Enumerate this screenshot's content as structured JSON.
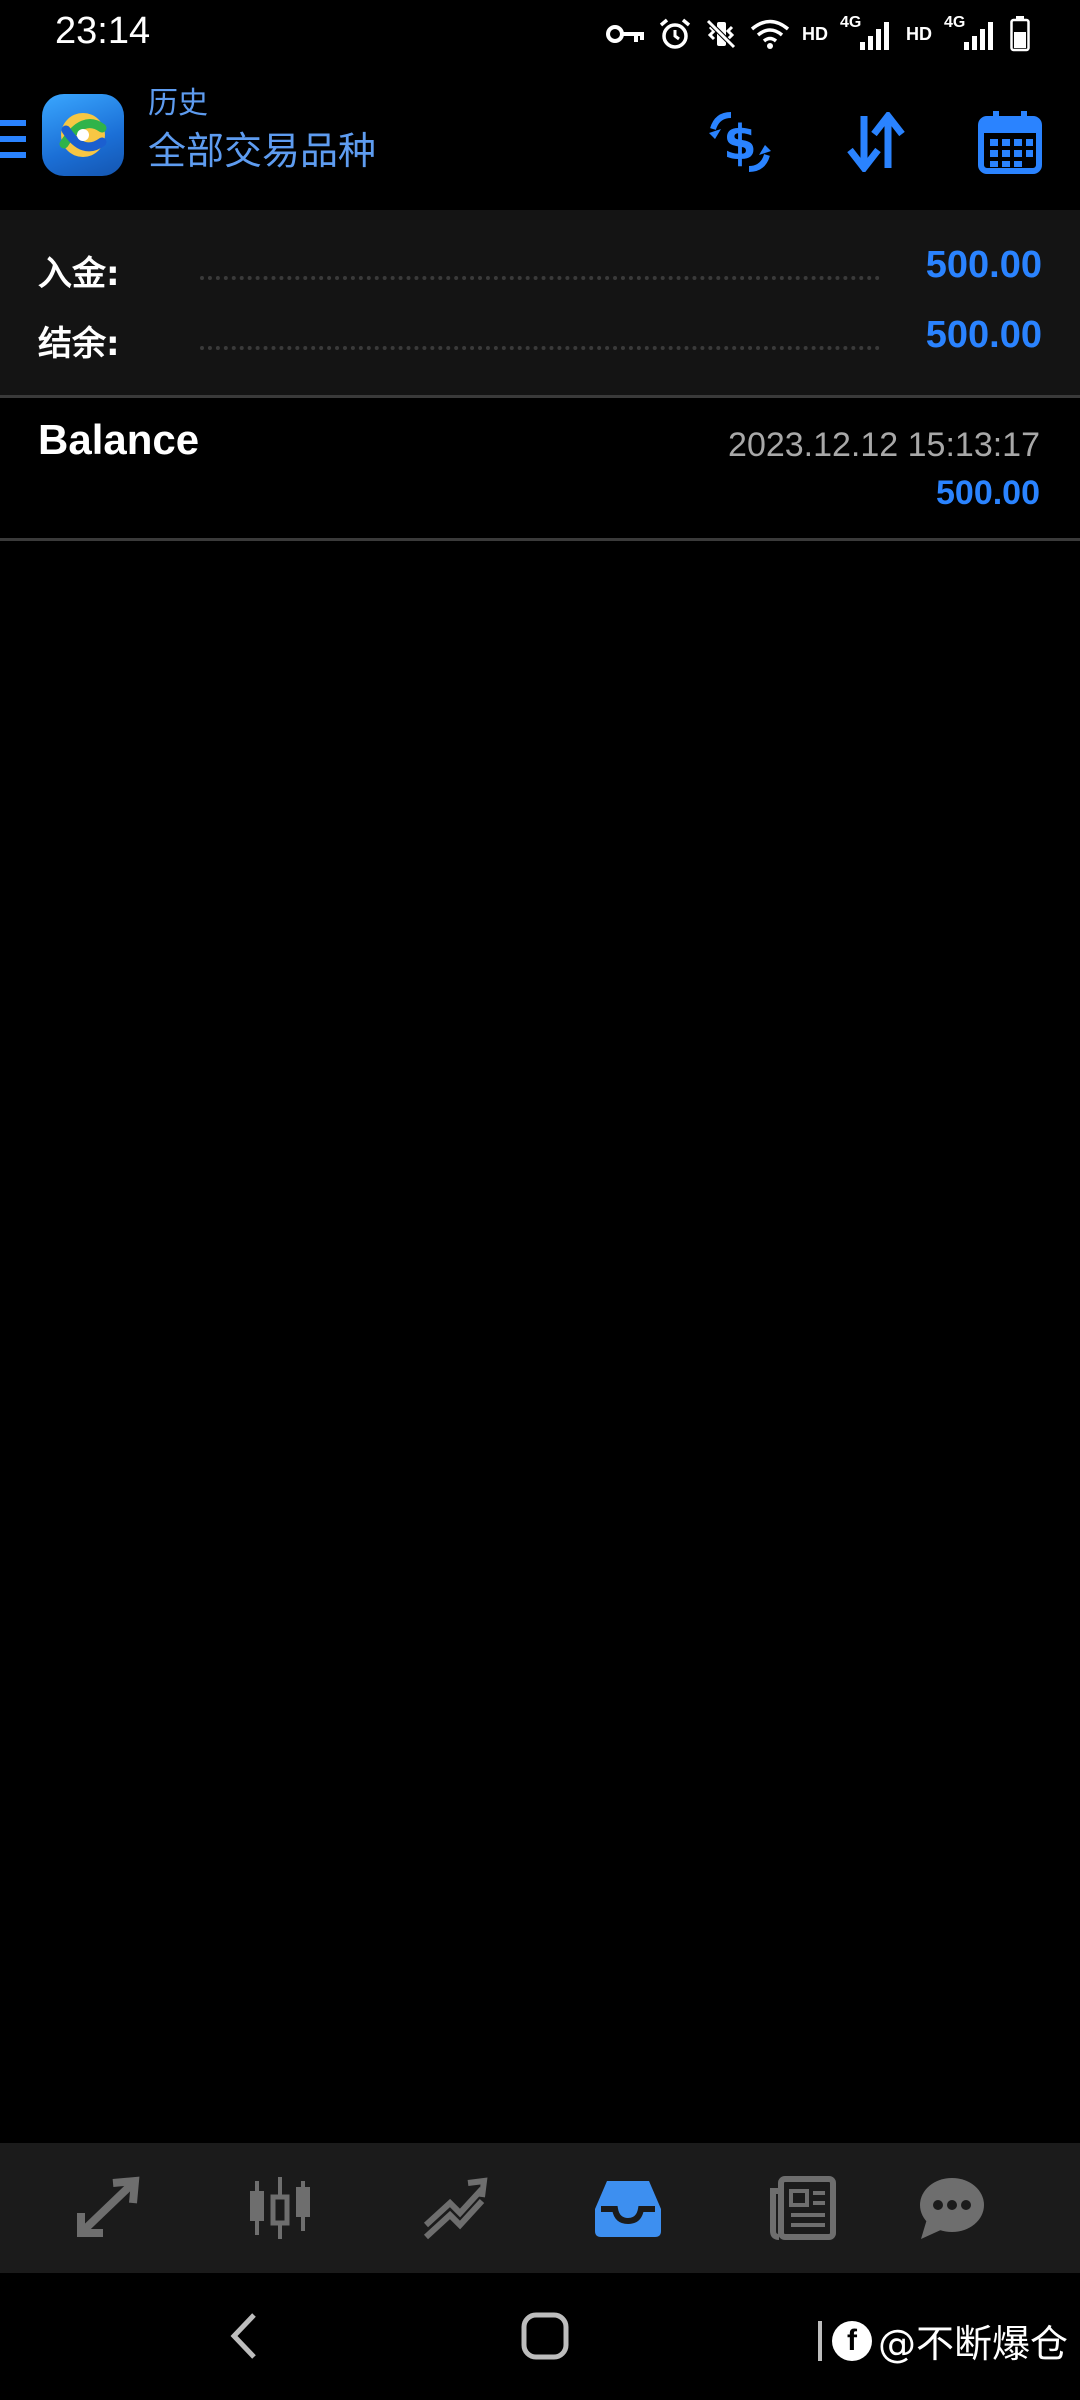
{
  "status_bar": {
    "time": "23:14",
    "indicators": [
      "HD",
      "4G",
      "HD",
      "4G"
    ],
    "icons": [
      "vpn-key-icon",
      "alarm-icon",
      "vibrate-icon",
      "wifi-icon",
      "signal-icon",
      "signal-icon",
      "battery-icon"
    ]
  },
  "app_bar": {
    "subtitle": "历史",
    "title": "全部交易品种",
    "actions": [
      "currency-exchange-icon",
      "sort-icon",
      "calendar-icon"
    ]
  },
  "summary": {
    "deposit_label": "入金:",
    "deposit_value": "500.00",
    "balance_label": "结余:",
    "balance_value": "500.00"
  },
  "deals": [
    {
      "type": "Balance",
      "time": "2023.12.12 15:13:17",
      "amount": "500.00"
    }
  ],
  "bottom_nav": {
    "active_index": 3,
    "items": [
      "quotes-icon",
      "chart-icon",
      "trade-icon",
      "history-icon",
      "news-icon",
      "chat-icon"
    ]
  },
  "watermark": {
    "badge": "f",
    "text": "@不断爆仓"
  },
  "colors": {
    "accent": "#2a83ff",
    "title": "#5e9cf0",
    "nav_bg": "#1b1b1b",
    "summary_bg": "#141414"
  }
}
